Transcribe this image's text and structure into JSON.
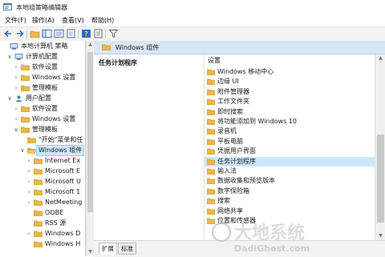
{
  "window": {
    "title": "本地组策略编辑器"
  },
  "menus": [
    "文件(F)",
    "操作(A)",
    "查看(V)",
    "帮助(H)"
  ],
  "tree": [
    {
      "label": "本地计算机 策略",
      "expander": "",
      "icon": "computer",
      "level": 0
    },
    {
      "label": "计算机配置",
      "expander": "∨",
      "icon": "computer",
      "level": 1
    },
    {
      "label": "软件设置",
      "expander": "›",
      "icon": "folder",
      "level": 2
    },
    {
      "label": "Windows 设置",
      "expander": "›",
      "icon": "folder",
      "level": 2
    },
    {
      "label": "管理模板",
      "expander": "›",
      "icon": "folder",
      "level": 2
    },
    {
      "label": "用户配置",
      "expander": "∨",
      "icon": "user",
      "level": 1
    },
    {
      "label": "软件设置",
      "expander": "›",
      "icon": "folder",
      "level": 2
    },
    {
      "label": "Windows 设置",
      "expander": "›",
      "icon": "folder",
      "level": 2
    },
    {
      "label": "管理模板",
      "expander": "∨",
      "icon": "folder",
      "level": 2
    },
    {
      "label": "\"开始\"菜单和任",
      "expander": "",
      "icon": "folder",
      "level": 3
    },
    {
      "label": "Windows 组件",
      "expander": "∨",
      "icon": "folder-open",
      "level": 3,
      "selected": true
    },
    {
      "label": "Internet Ex",
      "expander": "›",
      "icon": "folder",
      "level": 4
    },
    {
      "label": "Microsoft E",
      "expander": "›",
      "icon": "folder",
      "level": 4
    },
    {
      "label": "Microsoft U",
      "expander": "›",
      "icon": "folder",
      "level": 4
    },
    {
      "label": "Microsoft 1",
      "expander": "›",
      "icon": "folder",
      "level": 4
    },
    {
      "label": "NetMeeting",
      "expander": "›",
      "icon": "folder",
      "level": 4
    },
    {
      "label": "OOBE",
      "expander": "",
      "icon": "folder",
      "level": 4
    },
    {
      "label": "RSS 源",
      "expander": "",
      "icon": "folder",
      "level": 4
    },
    {
      "label": "Windows D",
      "expander": "›",
      "icon": "folder",
      "level": 4
    },
    {
      "label": "Windows H",
      "expander": "",
      "icon": "folder",
      "level": 4
    }
  ],
  "right_header": {
    "title": "Windows 组件"
  },
  "extended_pane": {
    "title": "任务计划程序"
  },
  "list": {
    "header": "设置",
    "items": [
      {
        "label": "Windows 移动中心"
      },
      {
        "label": "边缘 UI"
      },
      {
        "label": "附件管理器"
      },
      {
        "label": "工作文件夹"
      },
      {
        "label": "即时搜索"
      },
      {
        "label": "将功能添加到 Windows 10"
      },
      {
        "label": "录音机"
      },
      {
        "label": "平板电脑"
      },
      {
        "label": "凭据用户界面"
      },
      {
        "label": "任务计划程序",
        "selected": true
      },
      {
        "label": "输入法"
      },
      {
        "label": "数据收集和预览版本"
      },
      {
        "label": "数字保险箱"
      },
      {
        "label": "搜索"
      },
      {
        "label": "网络共享"
      },
      {
        "label": "位置和传感器"
      }
    ]
  },
  "tabs": [
    "扩展",
    "标准"
  ],
  "watermark": {
    "text": "DadiGhost.com"
  },
  "colors": {
    "selection": "#cce8ff",
    "header": "#d9e6f5",
    "folder": "#e8b84a"
  }
}
